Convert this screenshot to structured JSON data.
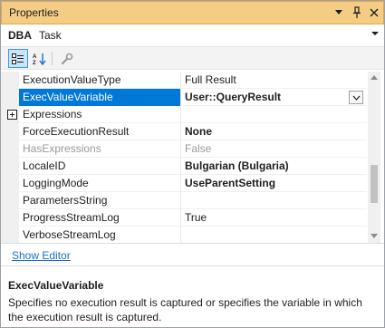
{
  "window": {
    "title": "Properties",
    "controls": [
      "chevron-down-icon",
      "pin-icon",
      "close-icon"
    ]
  },
  "object_selector": {
    "name": "DBA",
    "type": "Task"
  },
  "toolbar": {
    "buttons": [
      {
        "name": "categorized-view",
        "icon": "categorized-icon",
        "active": true
      },
      {
        "name": "alphabetical-view",
        "icon": "sort-az-icon",
        "active": false
      },
      {
        "name": "property-pages",
        "icon": "wrench-icon",
        "active": false
      }
    ]
  },
  "properties": {
    "rows": [
      {
        "name": "ExecutionValueType",
        "value": "Full Result",
        "bold": false,
        "dim": false
      },
      {
        "name": "ExecValueVariable",
        "value": "User::QueryResult",
        "bold": true,
        "dim": false,
        "selected": true
      },
      {
        "name": "Expressions",
        "value": "",
        "bold": false,
        "dim": false,
        "expandable": true
      },
      {
        "name": "ForceExecutionResult",
        "value": "None",
        "bold": true,
        "dim": false
      },
      {
        "name": "HasExpressions",
        "value": "False",
        "bold": false,
        "dim": true
      },
      {
        "name": "LocaleID",
        "value": "Bulgarian (Bulgaria)",
        "bold": true,
        "dim": false
      },
      {
        "name": "LoggingMode",
        "value": "UseParentSetting",
        "bold": true,
        "dim": false
      },
      {
        "name": "ParametersString",
        "value": "",
        "bold": false,
        "dim": false
      },
      {
        "name": "ProgressStreamLog",
        "value": "True",
        "bold": false,
        "dim": false
      },
      {
        "name": "VerboseStreamLog",
        "value": "",
        "bold": false,
        "dim": false
      }
    ]
  },
  "commands": {
    "show_editor": "Show Editor"
  },
  "description": {
    "title": "ExecValueVariable",
    "text": "Specifies no execution result is captured or specifies the variable in which the execution result is captured."
  },
  "colors": {
    "title_bar": "#f5cc84",
    "selection": "#0078d7",
    "link": "#1a6fc9"
  }
}
